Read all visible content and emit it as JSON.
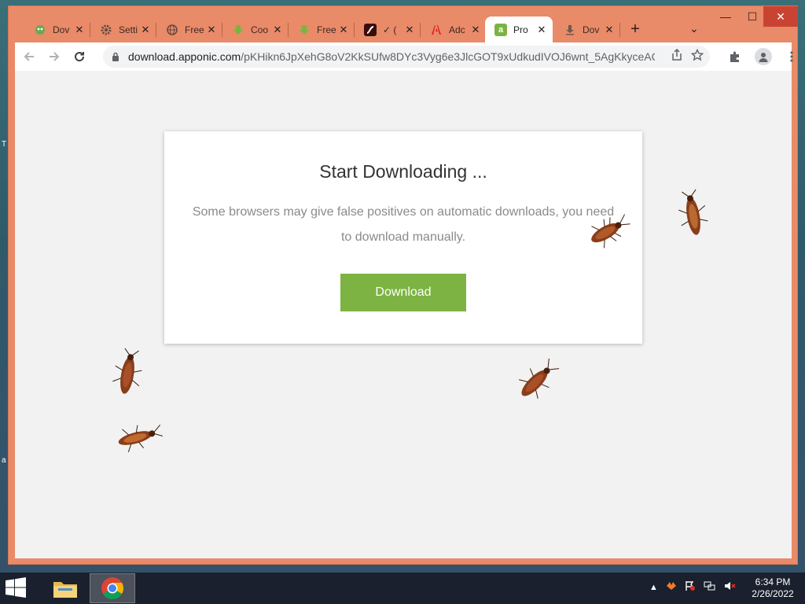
{
  "desktop": {
    "left_glyph_1": "T",
    "left_glyph_2": "a"
  },
  "tabs": [
    {
      "label": "Dov",
      "icon": "shield-icon",
      "active": false
    },
    {
      "label": "Setti",
      "icon": "gear-icon",
      "active": false
    },
    {
      "label": "Free",
      "icon": "globe-icon",
      "active": false
    },
    {
      "label": "Coo",
      "icon": "download-arrow-icon",
      "active": false
    },
    {
      "label": "Free",
      "icon": "download-arrow-icon",
      "active": false
    },
    {
      "label": "✓ (",
      "icon": "adobe-flash-icon",
      "active": false
    },
    {
      "label": "Adc",
      "icon": "adobe-icon",
      "active": false
    },
    {
      "label": "Pro",
      "icon": "apponic-icon",
      "active": true
    },
    {
      "label": "Dov",
      "icon": "download-icon",
      "active": false
    }
  ],
  "window_controls": {
    "minimize": "—",
    "maximize": "☐",
    "close": "✕"
  },
  "address_bar": {
    "url_host": "download.apponic.com",
    "url_path": "/pKHikn6JpXehG8oV2KkSUfw8DYc3Vyg6e3JlcGOT9xUdkudIVOJ6wnt_5AgKkyceACE..."
  },
  "page": {
    "heading": "Start Downloading ...",
    "message": "Some browsers may give false positives on automatic downloads, you need to download manually.",
    "button_label": "Download",
    "button_color": "#7cb342"
  },
  "taskbar": {
    "time": "6:34 PM",
    "date": "2/26/2022"
  },
  "colors": {
    "chrome_frame": "#e98a68",
    "close_button": "#c94333",
    "page_bg": "#f2f2f2"
  }
}
